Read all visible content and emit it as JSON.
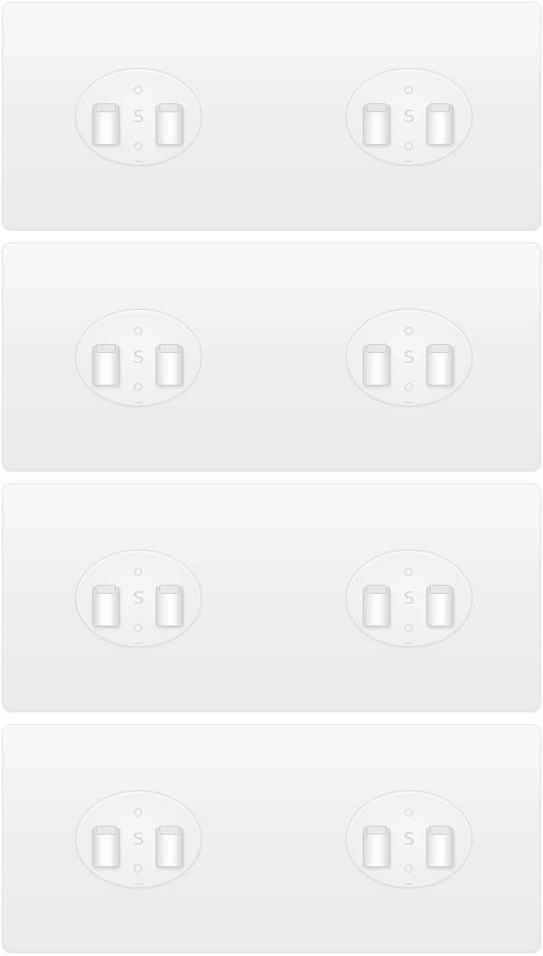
{
  "image": {
    "subject": "adhesive-wall-hook-plates",
    "background_color": "#ffffff",
    "plate_color": "#efeff0",
    "plates": [
      {
        "mounts": [
          {
            "emblem": "S"
          },
          {
            "emblem": "S"
          }
        ]
      },
      {
        "mounts": [
          {
            "emblem": "S"
          },
          {
            "emblem": "S"
          }
        ]
      },
      {
        "mounts": [
          {
            "emblem": "S"
          },
          {
            "emblem": "S"
          }
        ]
      },
      {
        "mounts": [
          {
            "emblem": "S"
          },
          {
            "emblem": "S"
          }
        ]
      }
    ]
  }
}
